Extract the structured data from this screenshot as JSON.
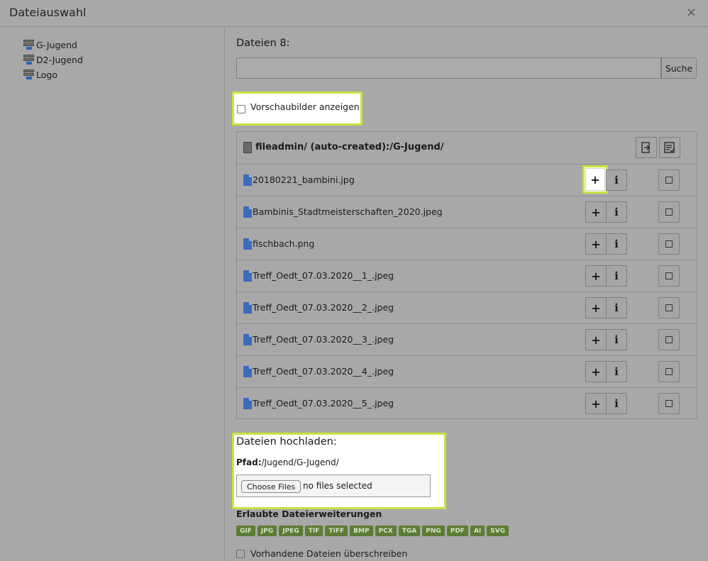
{
  "window": {
    "title": "Dateiauswahl",
    "close_glyph": "×"
  },
  "sidebar": {
    "items": [
      {
        "label": "G-Jugend",
        "icon": "storage-icon"
      },
      {
        "label": "D2-Jugend",
        "icon": "storage-icon"
      },
      {
        "label": "Logo",
        "icon": "storage-icon"
      }
    ]
  },
  "main": {
    "files_heading": "Dateien 8:",
    "search": {
      "value": "",
      "placeholder": "",
      "button_label": "Suche"
    },
    "thumbnails_label": "Vorschaubilder anzeigen",
    "folder_path": "fileadmin/ (auto-created):/G-Jugend/",
    "files": [
      {
        "name": "20180221_bambini.jpg"
      },
      {
        "name": "Bambinis_Stadtmeisterschaften_2020.jpeg"
      },
      {
        "name": "fischbach.png"
      },
      {
        "name": "Treff_Oedt_07.03.2020__1_.jpeg"
      },
      {
        "name": "Treff_Oedt_07.03.2020__2_.jpeg"
      },
      {
        "name": "Treff_Oedt_07.03.2020__3_.jpeg"
      },
      {
        "name": "Treff_Oedt_07.03.2020__4_.jpeg"
      },
      {
        "name": "Treff_Oedt_07.03.2020__5_.jpeg"
      }
    ],
    "add_glyph": "+",
    "info_glyph": "i"
  },
  "upload": {
    "title": "Dateien hochladen:",
    "path_label": "Pfad:",
    "path_value": "/Jugend/G-Jugend/",
    "choose_label": "Choose Files",
    "no_files": "no files selected",
    "extensions_title": "Erlaubte Dateierweiterungen",
    "extensions": [
      "GIF",
      "JPG",
      "JPEG",
      "TIF",
      "TIFF",
      "BMP",
      "PCX",
      "TGA",
      "PNG",
      "PDF",
      "AI",
      "SVG"
    ],
    "overwrite_label": "Vorhandene Dateien überschreiben"
  },
  "colors": {
    "highlight": "#c7e33f",
    "badge": "#5c7b35",
    "file_icon": "#3a6bbf"
  }
}
